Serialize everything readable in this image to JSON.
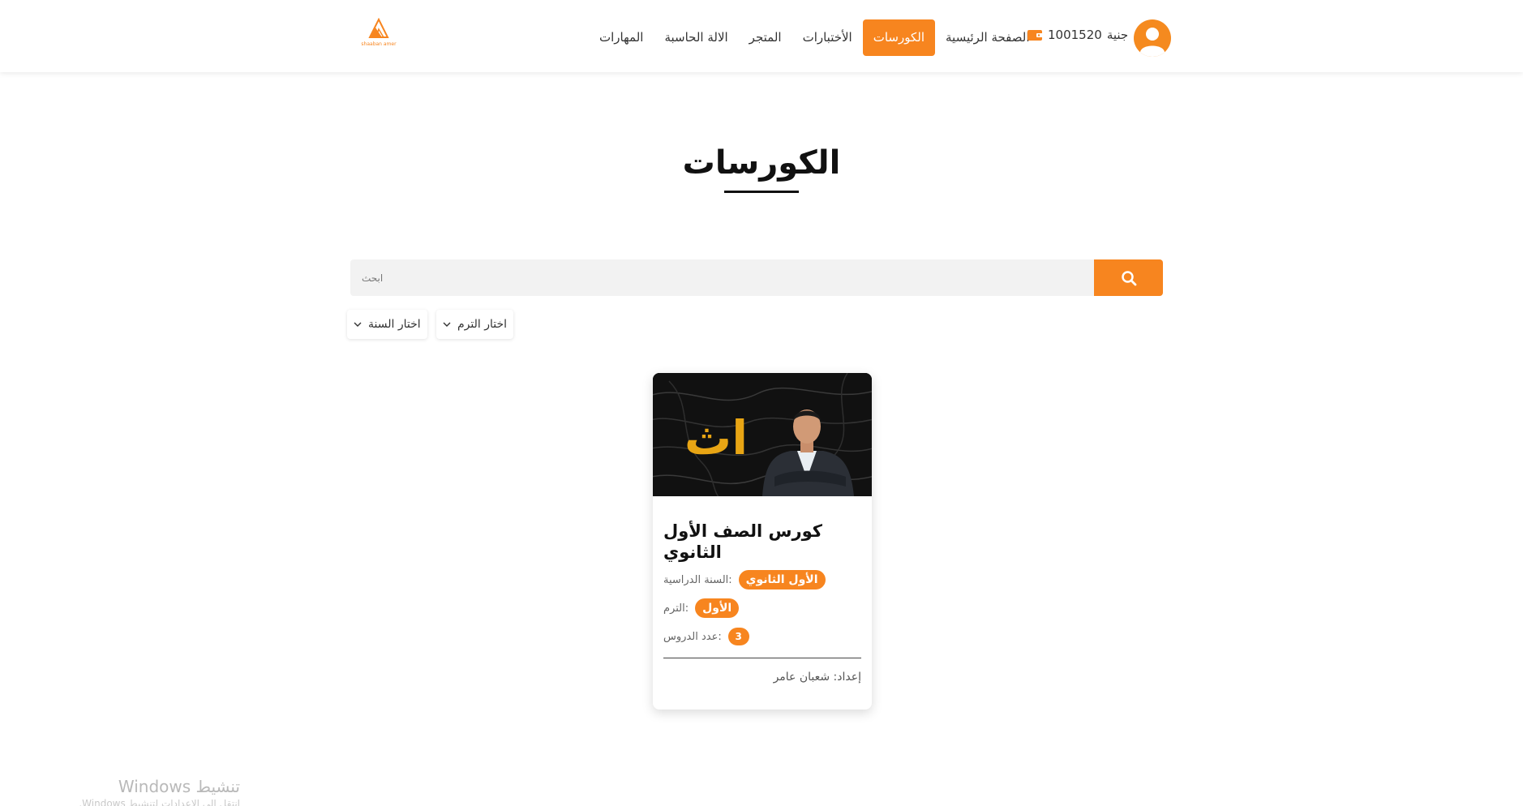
{
  "header": {
    "logo_text": "shaaban amer",
    "nav": [
      {
        "label": "الصفحة الرئيسية",
        "active": false
      },
      {
        "label": "الكورسات",
        "active": true
      },
      {
        "label": "الأختبارات",
        "active": false
      },
      {
        "label": "المتجر",
        "active": false
      },
      {
        "label": "الالة الحاسبة",
        "active": false
      },
      {
        "label": "المهارات",
        "active": false
      }
    ],
    "wallet": {
      "amount": "1001520",
      "currency": "جنية"
    }
  },
  "page_title": "الكورسات",
  "search": {
    "placeholder": "ابحث"
  },
  "filters": {
    "year_label": "اختار السنة",
    "term_label": "اختار الترم"
  },
  "course": {
    "image_text": "اث",
    "title": "كورس الصف الأول الثانوي",
    "year_label": ":السنة الدراسية",
    "year_value": "الأول الثانوي",
    "term_label": ":الترم",
    "term_value": "الأول",
    "lessons_label": ":عدد الدروس",
    "lessons_value": "3",
    "author": "إعداد: شعبان عامر"
  },
  "watermark": {
    "title": "تنشيط Windows",
    "subtitle": "انتقل إلى الإعدادات لتنشيط Windows."
  },
  "colors": {
    "accent": "#f7851f",
    "avatar": "#f58a1f",
    "image_gold": "#e8a514"
  }
}
